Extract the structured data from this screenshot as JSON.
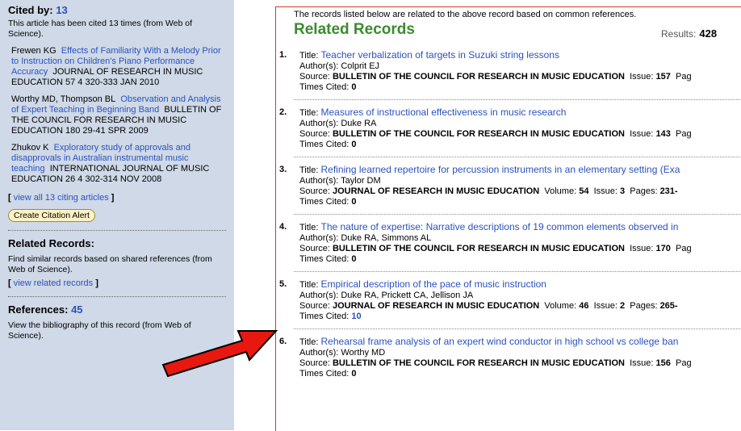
{
  "cited_by": {
    "heading": "Cited by:",
    "count": "13",
    "desc": "This article has been cited 13 times (from Web of Science).",
    "citations": [
      {
        "authors": "Frewen KG",
        "title": "Effects of Familiarity With a Melody Prior to Instruction on Children's Piano Performance Accuracy",
        "source": "JOURNAL OF RESEARCH IN MUSIC EDUCATION  57  4  320-333  JAN 2010"
      },
      {
        "authors": "Worthy MD, Thompson BL",
        "title": "Observation and Analysis of Expert Teaching in Beginning Band",
        "source": "BULLETIN OF THE COUNCIL FOR RESEARCH IN MUSIC EDUCATION  180  29-41  SPR 2009"
      },
      {
        "authors": "Zhukov K",
        "title": "Exploratory study of approvals and disapprovals in Australian instrumental music teaching",
        "source": "INTERNATIONAL JOURNAL OF MUSIC EDUCATION  26  4  302-314  NOV 2008"
      }
    ],
    "view_all_open": "[",
    "view_all_label": "view all 13 citing articles",
    "view_all_close": "]",
    "alert_button": "Create Citation Alert"
  },
  "related_sidebar": {
    "heading": "Related Records:",
    "desc": "Find similar records based on shared references (from Web of Science).",
    "link_open": "[",
    "link_label": "view related records",
    "link_close": "]"
  },
  "references": {
    "heading": "References:",
    "count": "45",
    "desc": "View the bibliography of this record (from Web of Science)."
  },
  "main": {
    "intro": "The records listed below are related to the above record based on common references.",
    "title": "Related Records",
    "results_label": "Results:",
    "results_count": "428",
    "labels": {
      "title": "Title:",
      "authors": "Author(s):",
      "source": "Source:",
      "times_cited": "Times Cited:",
      "volume": "Volume:",
      "issue": "Issue:",
      "pages": "Pages:",
      "page_trunc": "Pag"
    },
    "records": [
      {
        "num": "1.",
        "title": "Teacher verbalization of targets in Suzuki string lessons",
        "authors": "Colprit EJ",
        "source": "BULLETIN OF THE COUNCIL FOR RESEARCH IN MUSIC EDUCATION",
        "extra": "Issue: ",
        "issue": "157",
        "tail": "Pag",
        "cited": "0"
      },
      {
        "num": "2.",
        "title": "Measures of instructional effectiveness in music research",
        "authors": "Duke RA",
        "source": "BULLETIN OF THE COUNCIL FOR RESEARCH IN MUSIC EDUCATION",
        "extra": "Issue: ",
        "issue": "143",
        "tail": "Pag",
        "cited": "0"
      },
      {
        "num": "3.",
        "title": "Refining learned repertoire for percussion instruments in an elementary setting (Exa",
        "authors": "Taylor DM",
        "source": "JOURNAL OF RESEARCH IN MUSIC EDUCATION",
        "volume": "54",
        "issue": "3",
        "pages": "231-",
        "cited": "0"
      },
      {
        "num": "4.",
        "title": "The nature of expertise: Narrative descriptions of 19 common elements observed in",
        "authors": "Duke RA, Simmons AL",
        "source": "BULLETIN OF THE COUNCIL FOR RESEARCH IN MUSIC EDUCATION",
        "extra": "Issue: ",
        "issue": "170",
        "tail": "Pag",
        "cited": "0"
      },
      {
        "num": "5.",
        "title": "Empirical description of the pace of music instruction",
        "authors": "Duke RA, Prickett CA, Jellison JA",
        "source": "JOURNAL OF RESEARCH IN MUSIC EDUCATION",
        "volume": "46",
        "issue": "2",
        "pages": "265-",
        "cited": "10"
      },
      {
        "num": "6.",
        "title": "Rehearsal frame analysis of an expert wind conductor in high school vs college ban",
        "authors": "Worthy MD",
        "source": "BULLETIN OF THE COUNCIL FOR RESEARCH IN MUSIC EDUCATION",
        "extra": "Issue: ",
        "issue": "156",
        "tail": "Pag",
        "cited": "0"
      }
    ]
  },
  "colors": {
    "sidebar_bg": "#cfd9e7",
    "link": "#2a52be",
    "heading_green": "#3b8b2e",
    "arrow_red": "#e8170f"
  }
}
